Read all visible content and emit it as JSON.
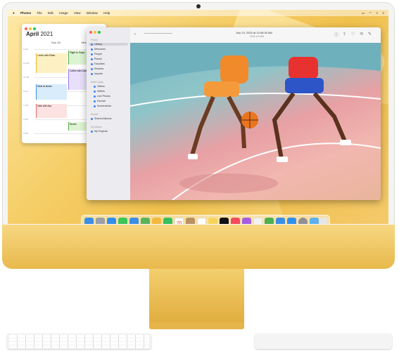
{
  "menubar": {
    "apple": "",
    "app_name": "Photos",
    "items": [
      "File",
      "Edit",
      "Image",
      "View",
      "Window",
      "Help"
    ],
    "status_icons": [
      "battery-icon",
      "wifi-icon",
      "search-icon",
      "control-center-icon"
    ]
  },
  "calendar": {
    "month": "April",
    "year": "2021",
    "days": [
      "Sun 18",
      "Mon 19"
    ],
    "times": [
      "9 AM",
      "10 AM",
      "11 AM",
      "Noon",
      "1 PM",
      "2 PM",
      "3 PM"
    ],
    "events": [
      {
        "text": "Lunch with Ethan",
        "color": "#f6d365"
      },
      {
        "text": "Flight to Tokyo",
        "color": "#b8e6a8"
      },
      {
        "text": "Coffee with Dani",
        "color": "#c9b8f0"
      },
      {
        "text": "Meet at studio",
        "color": "#9fd0f5"
      },
      {
        "text": "Date with Ava",
        "color": "#f8c4c4"
      },
      {
        "text": "Dinner",
        "color": "#b8e6a8"
      }
    ]
  },
  "photos": {
    "toolbar_title": "July 13, 2020 at 10:48:30 AM",
    "toolbar_subtitle": "2024 of 9,000",
    "sidebar": {
      "library_heading": "Photos",
      "library": [
        "Library",
        "Memories",
        "People",
        "Places",
        "Favorites",
        "Recents",
        "Imports"
      ],
      "media_heading": "Media Types",
      "media": [
        "Videos",
        "Selfies",
        "Live Photos",
        "Portrait",
        "Screenshots"
      ],
      "shared_heading": "Shared",
      "shared": [
        "Shared Albums"
      ],
      "albums_heading": "My Albums",
      "albums": [
        "My Projects"
      ]
    },
    "segments": [
      "Years",
      "Months",
      "Days",
      "All Photos"
    ]
  },
  "dock": {
    "apps": [
      {
        "name": "finder-icon",
        "color": "#3a8ee6"
      },
      {
        "name": "launchpad-icon",
        "color": "#9aa0a6"
      },
      {
        "name": "safari-icon",
        "color": "#2f8ff0"
      },
      {
        "name": "messages-icon",
        "color": "#3cc55a"
      },
      {
        "name": "mail-icon",
        "color": "#3a8ee6"
      },
      {
        "name": "maps-icon",
        "color": "#5ab35a"
      },
      {
        "name": "photos-icon",
        "color": "#f3b93c"
      },
      {
        "name": "facetime-icon",
        "color": "#37c05a"
      },
      {
        "name": "calendar-icon",
        "color": "#ffffff"
      },
      {
        "name": "contacts-icon",
        "color": "#b99263"
      },
      {
        "name": "reminders-icon",
        "color": "#ffffff"
      },
      {
        "name": "notes-icon",
        "color": "#f6d45a"
      },
      {
        "name": "tv-icon",
        "color": "#111111"
      },
      {
        "name": "music-icon",
        "color": "#f34b5d"
      },
      {
        "name": "podcasts-icon",
        "color": "#a55ee0"
      },
      {
        "name": "news-icon",
        "color": "#f2f2f2"
      },
      {
        "name": "numbers-icon",
        "color": "#4caf50"
      },
      {
        "name": "keynote-icon",
        "color": "#3a8ee6"
      },
      {
        "name": "appstore-icon",
        "color": "#2f8ff0"
      },
      {
        "name": "settings-icon",
        "color": "#8e8e93"
      },
      {
        "name": "folder-icon",
        "color": "#5ab0f0"
      },
      {
        "name": "trash-icon",
        "color": "#e5e5e5"
      }
    ],
    "calendar_day": "20"
  }
}
